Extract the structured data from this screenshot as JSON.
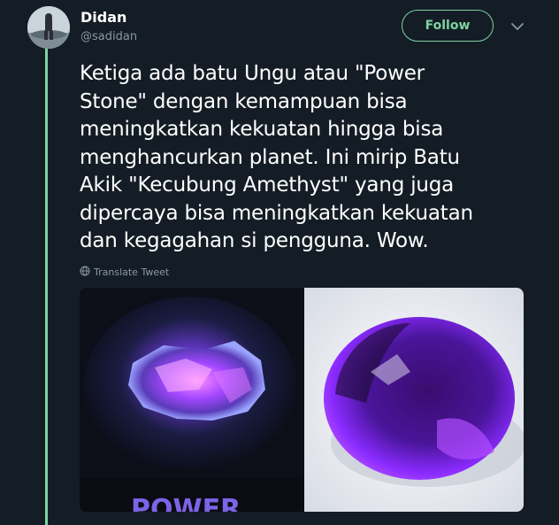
{
  "user": {
    "name": "Didan",
    "handle": "@sadidan"
  },
  "actions": {
    "follow_label": "Follow"
  },
  "tweet": {
    "lines": [
      "Ketiga ada batu Ungu atau \"Power",
      "Stone\" dengan kemampuan bisa",
      "meningkatkan kekuatan hingga bisa",
      "menghancurkan planet. Ini mirip Batu",
      "Akik \"Kecubung Amethyst\" yang juga",
      "dipercaya bisa meningkatkan kekuatan",
      "dan kegagahan si pengguna. Wow."
    ],
    "translate_label": "Translate Tweet"
  },
  "media": {
    "left_caption": "POWER"
  },
  "colors": {
    "background": "#141d26",
    "accent": "#7ed39f",
    "muted": "#8899a6",
    "text": "#ffffff"
  },
  "icons": {
    "caret": "chevron-down-icon",
    "translate": "globe-icon"
  }
}
